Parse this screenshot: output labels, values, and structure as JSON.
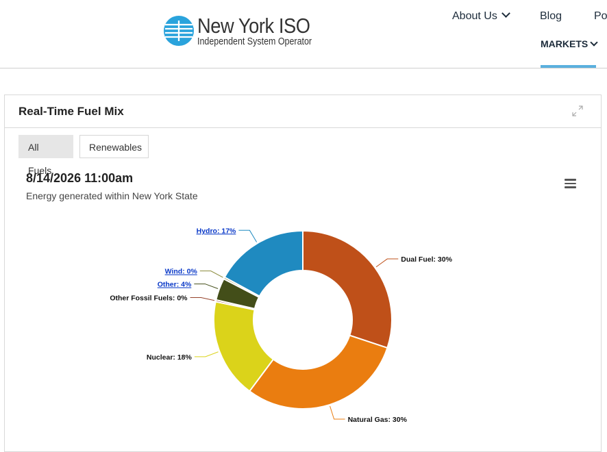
{
  "header": {
    "logo": {
      "name": "New York ISO",
      "subtitle": "Independent System Operator"
    },
    "nav": {
      "about": "About Us",
      "blog": "Blog",
      "partial": "Po",
      "markets": "MARKETS"
    },
    "accent_color": "#5ab0de"
  },
  "widget": {
    "title": "Real-Time Fuel Mix",
    "tabs": [
      {
        "label": "All Fuels",
        "active": true
      },
      {
        "label": "Renewables",
        "active": false
      }
    ],
    "menu_icon": "hamburger-icon",
    "expand_icon": "expand-icon"
  },
  "chart_data": {
    "type": "pie",
    "style": "donut",
    "title": "8/14/2026 11:00am",
    "subtitle": "Energy generated within New York State",
    "slices": [
      {
        "name": "Dual Fuel",
        "percent": 30,
        "label": "Dual Fuel: 30%",
        "color": "#bf5019",
        "link": false
      },
      {
        "name": "Natural Gas",
        "percent": 30,
        "label": "Natural Gas: 30%",
        "color": "#ea7d10",
        "link": false
      },
      {
        "name": "Nuclear",
        "percent": 18,
        "label": "Nuclear: 18%",
        "color": "#dbd31a",
        "link": false
      },
      {
        "name": "Other Fossil Fuels",
        "percent": 0,
        "label": "Other Fossil Fuels: 0%",
        "color": "#95422a",
        "link": false
      },
      {
        "name": "Other",
        "percent": 4,
        "label": "Other: 4%",
        "color": "#434e19",
        "link": true
      },
      {
        "name": "Wind",
        "percent": 0,
        "label": "Wind: 0%",
        "color": "#8a8a3a",
        "link": true
      },
      {
        "name": "Hydro",
        "percent": 17,
        "label": "Hydro: 17%",
        "color": "#1f8ac0",
        "link": true
      }
    ]
  }
}
